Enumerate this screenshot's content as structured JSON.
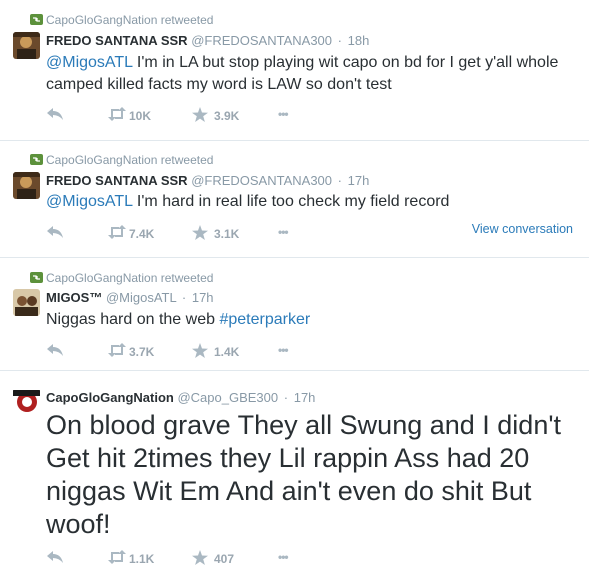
{
  "tweets": [
    {
      "retweeted_by": "CapoGloGangNation retweeted",
      "name": "FREDO SANTANA SSR",
      "handle": "@FREDOSANTANA300",
      "sep": "·",
      "time": "18h",
      "mention": "@MigosATL",
      "text_line1": " I'm in LA but stop playing wit capo on bd for I get y'all whole",
      "text_line2": "camped killed facts my word is LAW so don't test",
      "retweets": "10K",
      "favorites": "3.9K",
      "more": "•••"
    },
    {
      "retweeted_by": "CapoGloGangNation retweeted",
      "name": "FREDO SANTANA SSR",
      "handle": "@FREDOSANTANA300",
      "sep": "·",
      "time": "17h",
      "mention": "@MigosATL",
      "text": " I'm hard in real life too check my field record",
      "retweets": "7.4K",
      "favorites": "3.1K",
      "more": "•••",
      "view_conversation": "View conversation"
    },
    {
      "retweeted_by": "CapoGloGangNation retweeted",
      "name": "MIGOS™",
      "handle": "@MigosATL",
      "sep": "·",
      "time": "17h",
      "text": "Niggas hard on the web ",
      "hashtag": "#peterparker",
      "retweets": "3.7K",
      "favorites": "1.4K",
      "more": "•••"
    },
    {
      "name": "CapoGloGangNation",
      "handle": "@Capo_GBE300",
      "sep": "·",
      "time": "17h",
      "text_line1": "On blood grave They all Swung and I didn't",
      "text_line2": "Get hit 2times they Lil rappin Ass had 20",
      "text_line3": "niggas Wit Em And ain't even do shit But",
      "text_line4": "woof!",
      "retweets": "1.1K",
      "favorites": "407",
      "more": "•••"
    }
  ],
  "icons": {
    "reply": "reply-icon",
    "retweet": "retweet-icon",
    "favorite": "star-icon",
    "more": "more-icon"
  },
  "colors": {
    "link": "#2b7bb9",
    "meta": "#8899a6",
    "retweet_green": "#5c913b",
    "text": "#292f33"
  }
}
